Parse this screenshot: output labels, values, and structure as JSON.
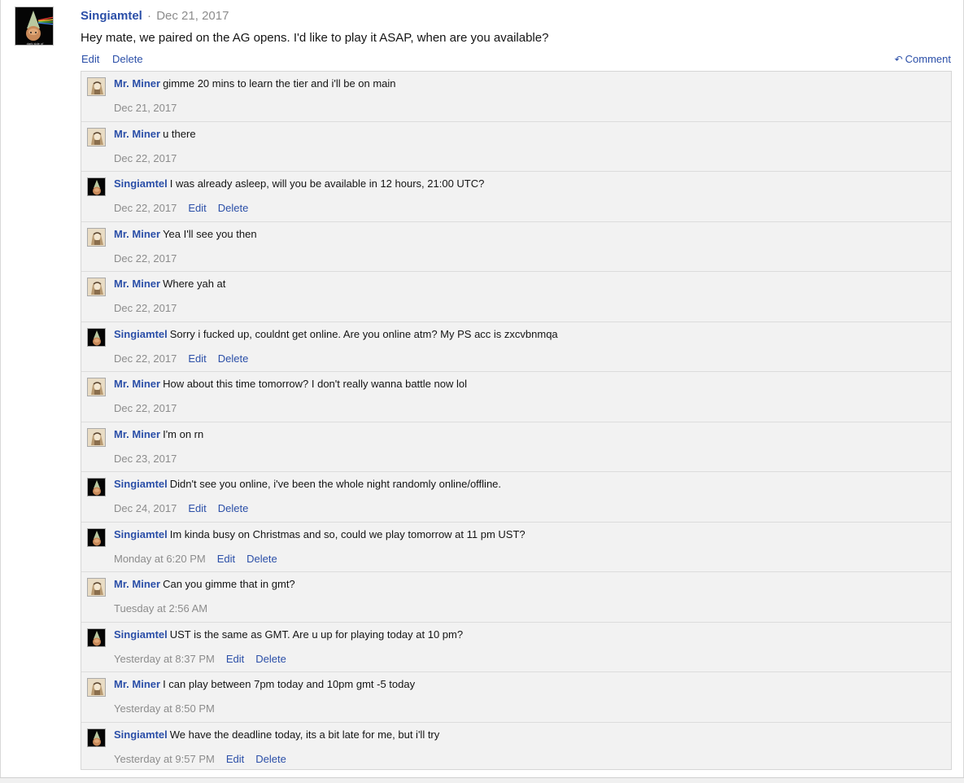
{
  "post": {
    "author": "Singiamtel",
    "separator": "·",
    "date": "Dec 21, 2017",
    "text": "Hey mate, we paired on the AG opens. I'd like to play it ASAP, when are you available?",
    "avatar_caption": "dark side of",
    "edit_label": "Edit",
    "delete_label": "Delete",
    "comment_label": "Comment",
    "comment_icon": "reply-arrow-icon"
  },
  "replies": [
    {
      "author": "Mr. Miner",
      "avatar": "miner",
      "text": "gimme 20 mins to learn the tier and i'll be on main",
      "date": "Dec 21, 2017"
    },
    {
      "author": "Mr. Miner",
      "avatar": "miner",
      "text": "u there",
      "date": "Dec 22, 2017"
    },
    {
      "author": "Singiamtel",
      "avatar": "singiamtel",
      "text": "I was already asleep, will you be available in 12 hours, 21:00 UTC?",
      "date": "Dec 22, 2017",
      "edit": "Edit",
      "delete": "Delete"
    },
    {
      "author": "Mr. Miner",
      "avatar": "miner",
      "text": "Yea I'll see you then",
      "date": "Dec 22, 2017"
    },
    {
      "author": "Mr. Miner",
      "avatar": "miner",
      "text": "Where yah at",
      "date": "Dec 22, 2017"
    },
    {
      "author": "Singiamtel",
      "avatar": "singiamtel",
      "text": "Sorry i fucked up, couldnt get online. Are you online atm? My PS acc is zxcvbnmqa",
      "date": "Dec 22, 2017",
      "edit": "Edit",
      "delete": "Delete"
    },
    {
      "author": "Mr. Miner",
      "avatar": "miner",
      "text": "How about this time tomorrow? I don't really wanna battle now lol",
      "date": "Dec 22, 2017"
    },
    {
      "author": "Mr. Miner",
      "avatar": "miner",
      "text": "I'm on rn",
      "date": "Dec 23, 2017"
    },
    {
      "author": "Singiamtel",
      "avatar": "singiamtel",
      "text": "Didn't see you online, i've been the whole night randomly online/offline.",
      "date": "Dec 24, 2017",
      "edit": "Edit",
      "delete": "Delete"
    },
    {
      "author": "Singiamtel",
      "avatar": "singiamtel",
      "text": "Im kinda busy on Christmas and so, could we play tomorrow at 11 pm UST?",
      "date": "Monday at 6:20 PM",
      "edit": "Edit",
      "delete": "Delete"
    },
    {
      "author": "Mr. Miner",
      "avatar": "miner",
      "text": "Can you gimme that in gmt?",
      "date": "Tuesday at 2:56 AM"
    },
    {
      "author": "Singiamtel",
      "avatar": "singiamtel",
      "text": "UST is the same as GMT. Are u up for playing today at 10 pm?",
      "date": "Yesterday at 8:37 PM",
      "edit": "Edit",
      "delete": "Delete"
    },
    {
      "author": "Mr. Miner",
      "avatar": "miner",
      "text": "I can play between 7pm today and 10pm gmt -5 today",
      "date": "Yesterday at 8:50 PM"
    },
    {
      "author": "Singiamtel",
      "avatar": "singiamtel",
      "text": "We have the deadline today, its a bit late for me, but i'll try",
      "date": "Yesterday at 9:57 PM",
      "edit": "Edit",
      "delete": "Delete"
    }
  ],
  "colors": {
    "link": "#2b4fa8",
    "muted": "#8c8c8c",
    "reply_bg": "#f2f2f2"
  }
}
